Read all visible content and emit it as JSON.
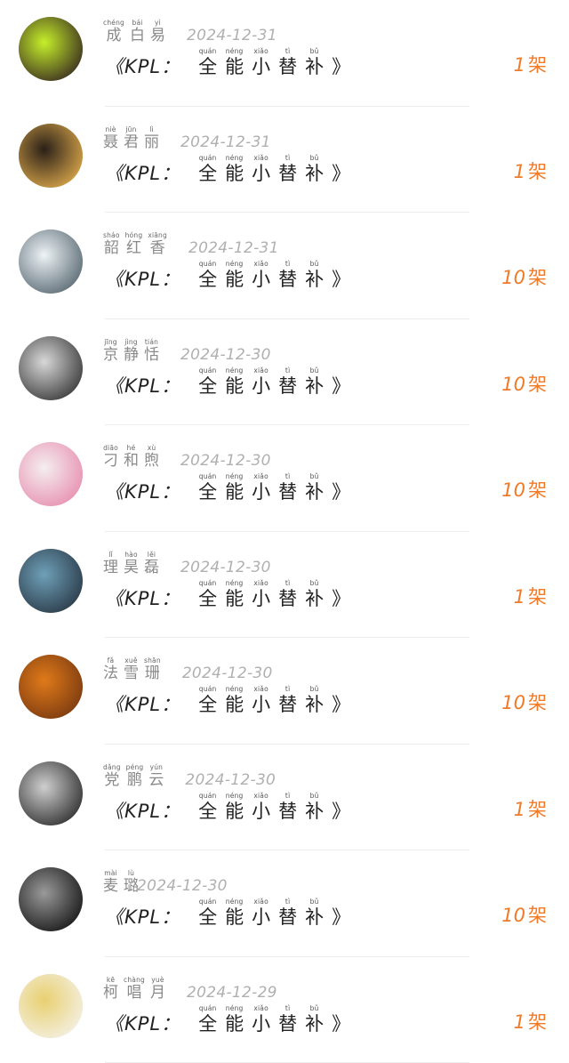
{
  "records": [
    {
      "name": [
        {
          "hz": "成",
          "py": "chéng"
        },
        {
          "hz": "白",
          "py": "bái"
        },
        {
          "hz": "易",
          "py": "yì"
        }
      ],
      "date": "2024-12-31",
      "title": {
        "prefix": "《KPL：",
        "chars": [
          {
            "hz": "全",
            "py": "quán"
          },
          {
            "hz": "能",
            "py": "néng"
          },
          {
            "hz": "小",
            "py": "xiǎo"
          },
          {
            "hz": "替",
            "py": "tì"
          },
          {
            "hz": "补",
            "py": "bǔ"
          }
        ],
        "suffix": "》"
      },
      "count": "1",
      "unit": "架",
      "avatar_colors": [
        "#c6f02a",
        "#3a2c20"
      ]
    },
    {
      "name": [
        {
          "hz": "聂",
          "py": "niè"
        },
        {
          "hz": "君",
          "py": "jūn"
        },
        {
          "hz": "丽",
          "py": "lì"
        }
      ],
      "date": "2024-12-31",
      "title": {
        "prefix": "《KPL：",
        "chars": [
          {
            "hz": "全",
            "py": "quán"
          },
          {
            "hz": "能",
            "py": "néng"
          },
          {
            "hz": "小",
            "py": "xiǎo"
          },
          {
            "hz": "替",
            "py": "tì"
          },
          {
            "hz": "补",
            "py": "bǔ"
          }
        ],
        "suffix": "》"
      },
      "count": "1",
      "unit": "架",
      "avatar_colors": [
        "#2a2018",
        "#d9a64a"
      ]
    },
    {
      "name": [
        {
          "hz": "韶",
          "py": "sháo"
        },
        {
          "hz": "红",
          "py": "hóng"
        },
        {
          "hz": "香",
          "py": "xiāng"
        }
      ],
      "date": "2024-12-31",
      "title": {
        "prefix": "《KPL：",
        "chars": [
          {
            "hz": "全",
            "py": "quán"
          },
          {
            "hz": "能",
            "py": "néng"
          },
          {
            "hz": "小",
            "py": "xiǎo"
          },
          {
            "hz": "替",
            "py": "tì"
          },
          {
            "hz": "补",
            "py": "bǔ"
          }
        ],
        "suffix": "》"
      },
      "count": "10",
      "unit": "架",
      "avatar_colors": [
        "#eef3f6",
        "#5a6a74"
      ]
    },
    {
      "name": [
        {
          "hz": "京",
          "py": "jīng"
        },
        {
          "hz": "静",
          "py": "jìng"
        },
        {
          "hz": "恬",
          "py": "tián"
        }
      ],
      "date": "2024-12-30",
      "title": {
        "prefix": "《KPL：",
        "chars": [
          {
            "hz": "全",
            "py": "quán"
          },
          {
            "hz": "能",
            "py": "néng"
          },
          {
            "hz": "小",
            "py": "xiǎo"
          },
          {
            "hz": "替",
            "py": "tì"
          },
          {
            "hz": "补",
            "py": "bǔ"
          }
        ],
        "suffix": "》"
      },
      "count": "10",
      "unit": "架",
      "avatar_colors": [
        "#d8d8d8",
        "#3a3a3a"
      ]
    },
    {
      "name": [
        {
          "hz": "刁",
          "py": "diāo"
        },
        {
          "hz": "和",
          "py": "hé"
        },
        {
          "hz": "煦",
          "py": "xù"
        }
      ],
      "date": "2024-12-30",
      "title": {
        "prefix": "《KPL：",
        "chars": [
          {
            "hz": "全",
            "py": "quán"
          },
          {
            "hz": "能",
            "py": "néng"
          },
          {
            "hz": "小",
            "py": "xiǎo"
          },
          {
            "hz": "替",
            "py": "tì"
          },
          {
            "hz": "补",
            "py": "bǔ"
          }
        ],
        "suffix": "》"
      },
      "count": "10",
      "unit": "架",
      "avatar_colors": [
        "#f4eef0",
        "#e890b0"
      ]
    },
    {
      "name": [
        {
          "hz": "理",
          "py": "lǐ"
        },
        {
          "hz": "昊",
          "py": "hào"
        },
        {
          "hz": "磊",
          "py": "lěi"
        }
      ],
      "date": "2024-12-30",
      "title": {
        "prefix": "《KPL：",
        "chars": [
          {
            "hz": "全",
            "py": "quán"
          },
          {
            "hz": "能",
            "py": "néng"
          },
          {
            "hz": "小",
            "py": "xiǎo"
          },
          {
            "hz": "替",
            "py": "tì"
          },
          {
            "hz": "补",
            "py": "bǔ"
          }
        ],
        "suffix": "》"
      },
      "count": "1",
      "unit": "架",
      "avatar_colors": [
        "#6fa0b8",
        "#2a3a48"
      ]
    },
    {
      "name": [
        {
          "hz": "法",
          "py": "fǎ"
        },
        {
          "hz": "雪",
          "py": "xuě"
        },
        {
          "hz": "珊",
          "py": "shān"
        }
      ],
      "date": "2024-12-30",
      "title": {
        "prefix": "《KPL：",
        "chars": [
          {
            "hz": "全",
            "py": "quán"
          },
          {
            "hz": "能",
            "py": "néng"
          },
          {
            "hz": "小",
            "py": "xiǎo"
          },
          {
            "hz": "替",
            "py": "tì"
          },
          {
            "hz": "补",
            "py": "bǔ"
          }
        ],
        "suffix": "》"
      },
      "count": "10",
      "unit": "架",
      "avatar_colors": [
        "#e07a1a",
        "#7a3a10"
      ]
    },
    {
      "name": [
        {
          "hz": "党",
          "py": "dǎng"
        },
        {
          "hz": "鹏",
          "py": "péng"
        },
        {
          "hz": "云",
          "py": "yún"
        }
      ],
      "date": "2024-12-30",
      "title": {
        "prefix": "《KPL：",
        "chars": [
          {
            "hz": "全",
            "py": "quán"
          },
          {
            "hz": "能",
            "py": "néng"
          },
          {
            "hz": "小",
            "py": "xiǎo"
          },
          {
            "hz": "替",
            "py": "tì"
          },
          {
            "hz": "补",
            "py": "bǔ"
          }
        ],
        "suffix": "》"
      },
      "count": "1",
      "unit": "架",
      "avatar_colors": [
        "#cfcfcf",
        "#303030"
      ]
    },
    {
      "name": [
        {
          "hz": "麦",
          "py": "mài"
        },
        {
          "hz": "璐",
          "py": "lù"
        }
      ],
      "date": "2024-12-30",
      "title": {
        "prefix": "《KPL：",
        "chars": [
          {
            "hz": "全",
            "py": "quán"
          },
          {
            "hz": "能",
            "py": "néng"
          },
          {
            "hz": "小",
            "py": "xiǎo"
          },
          {
            "hz": "替",
            "py": "tì"
          },
          {
            "hz": "补",
            "py": "bǔ"
          }
        ],
        "suffix": "》"
      },
      "count": "10",
      "unit": "架",
      "avatar_colors": [
        "#9a9a9a",
        "#181818"
      ]
    },
    {
      "name": [
        {
          "hz": "柯",
          "py": "kē"
        },
        {
          "hz": "唱",
          "py": "chàng"
        },
        {
          "hz": "月",
          "py": "yuè"
        }
      ],
      "date": "2024-12-29",
      "title": {
        "prefix": "《KPL：",
        "chars": [
          {
            "hz": "全",
            "py": "quán"
          },
          {
            "hz": "能",
            "py": "néng"
          },
          {
            "hz": "小",
            "py": "xiǎo"
          },
          {
            "hz": "替",
            "py": "tì"
          },
          {
            "hz": "补",
            "py": "bǔ"
          }
        ],
        "suffix": "》"
      },
      "count": "1",
      "unit": "架",
      "avatar_colors": [
        "#e8d070",
        "#f4f0e4"
      ]
    }
  ]
}
